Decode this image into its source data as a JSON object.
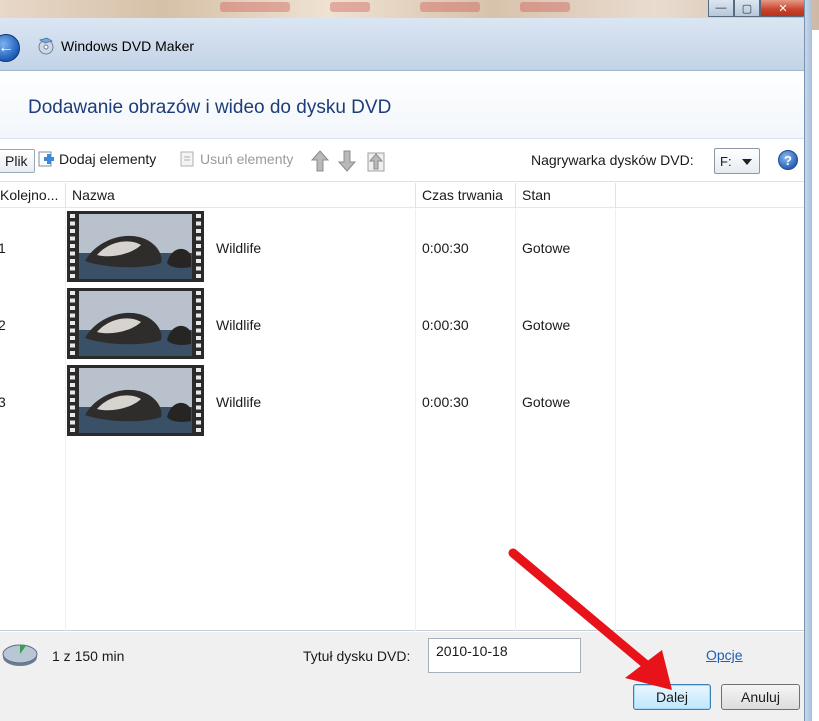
{
  "window": {
    "app_title": "Windows DVD Maker",
    "page_heading": "Dodawanie obrazów i wideo do dysku DVD"
  },
  "toolbar": {
    "file_label": "Plik",
    "add_label": "Dodaj elementy",
    "remove_label": "Usuń elementy",
    "burner_label": "Nagrywarka dysków DVD:",
    "burner_value": "F:"
  },
  "columns": {
    "order": "Kolejno...",
    "name": "Nazwa",
    "duration": "Czas trwania",
    "status": "Stan"
  },
  "rows": [
    {
      "num": "1",
      "name": "Wildlife",
      "duration": "0:00:30",
      "status": "Gotowe"
    },
    {
      "num": "2",
      "name": "Wildlife",
      "duration": "0:00:30",
      "status": "Gotowe"
    },
    {
      "num": "3",
      "name": "Wildlife",
      "duration": "0:00:30",
      "status": "Gotowe"
    }
  ],
  "footer": {
    "capacity": "1 z 150 min",
    "dvd_title_label": "Tytuł dysku DVD:",
    "dvd_title_value": "2010-10-18",
    "options_link": "Opcje",
    "next_button": "Dalej",
    "cancel_button": "Anuluj"
  },
  "colors": {
    "heading": "#1e3d78",
    "link": "#1a5fb4",
    "annotation_arrow": "#e8121b"
  }
}
